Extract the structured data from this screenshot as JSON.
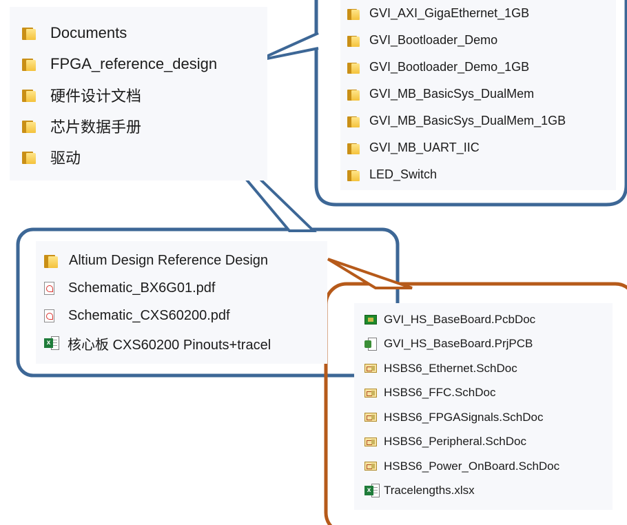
{
  "root_folder": {
    "items": [
      {
        "icon": "folder-icon",
        "label": "Documents"
      },
      {
        "icon": "folder-icon",
        "label": "FPGA_reference_design"
      },
      {
        "icon": "folder-icon",
        "label": "硬件设计文档"
      },
      {
        "icon": "folder-icon",
        "label": "芯片数据手册"
      },
      {
        "icon": "folder-icon",
        "label": "驱动"
      }
    ]
  },
  "fpga_reference_design_folder": {
    "items": [
      {
        "icon": "folder-icon",
        "label": "GVI_AXI_GigaEthernet_1GB"
      },
      {
        "icon": "folder-icon",
        "label": "GVI_Bootloader_Demo"
      },
      {
        "icon": "folder-icon",
        "label": "GVI_Bootloader_Demo_1GB"
      },
      {
        "icon": "folder-icon",
        "label": "GVI_MB_BasicSys_DualMem"
      },
      {
        "icon": "folder-icon",
        "label": "GVI_MB_BasicSys_DualMem_1GB"
      },
      {
        "icon": "folder-icon",
        "label": "GVI_MB_UART_IIC"
      },
      {
        "icon": "folder-icon",
        "label": "LED_Switch"
      }
    ]
  },
  "hardware_docs_folder": {
    "items": [
      {
        "icon": "folder-icon",
        "label": "Altium Design Reference Design"
      },
      {
        "icon": "pdf-icon",
        "label": "Schematic_BX6G01.pdf"
      },
      {
        "icon": "pdf-icon",
        "label": "Schematic_CXS60200.pdf"
      },
      {
        "icon": "excel-icon",
        "label": "核心板 CXS60200 Pinouts+tracel"
      }
    ]
  },
  "altium_reference_design_folder": {
    "items": [
      {
        "icon": "pcbdoc-icon",
        "label": "GVI_HS_BaseBoard.PcbDoc"
      },
      {
        "icon": "prjpcb-icon",
        "label": "GVI_HS_BaseBoard.PrjPCB"
      },
      {
        "icon": "schdoc-icon",
        "label": "HSBS6_Ethernet.SchDoc"
      },
      {
        "icon": "schdoc-icon",
        "label": "HSBS6_FFC.SchDoc"
      },
      {
        "icon": "schdoc-icon",
        "label": "HSBS6_FPGASignals.SchDoc"
      },
      {
        "icon": "schdoc-icon",
        "label": "HSBS6_Peripheral.SchDoc"
      },
      {
        "icon": "schdoc-icon",
        "label": "HSBS6_Power_OnBoard.SchDoc"
      },
      {
        "icon": "excel-icon",
        "label": "Tracelengths.xlsx"
      }
    ]
  },
  "colors": {
    "blue_callout": "#3d6796",
    "orange_callout": "#b65a1a",
    "folder_yellow": "#f4c23c"
  }
}
